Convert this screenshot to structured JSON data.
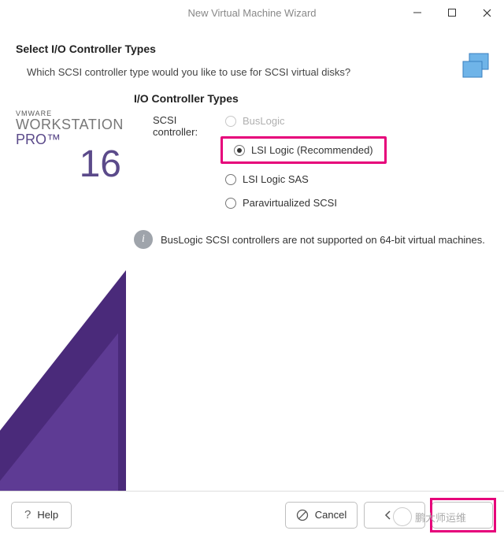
{
  "window": {
    "title": "New Virtual Machine Wizard"
  },
  "header": {
    "title": "Select I/O Controller Types",
    "subtitle": "Which SCSI controller type would you like to use for SCSI virtual disks?"
  },
  "brand": {
    "vendor": "VMWARE",
    "line1": "WORKSTATION",
    "line2": "PRO™",
    "version": "16"
  },
  "content": {
    "section_title": "I/O Controller Types",
    "label": "SCSI controller:",
    "options": {
      "buslogic": "BusLogic",
      "lsi": "LSI Logic (Recommended)",
      "lsi_sas": "LSI Logic SAS",
      "paravirt": "Paravirtualized SCSI"
    },
    "selected": "lsi",
    "info": "BusLogic SCSI controllers are not supported on 64-bit virtual machines."
  },
  "footer": {
    "help": "Help",
    "cancel": "Cancel",
    "back": "Back",
    "back_visible": "B"
  },
  "watermark": "鹏大师运维"
}
